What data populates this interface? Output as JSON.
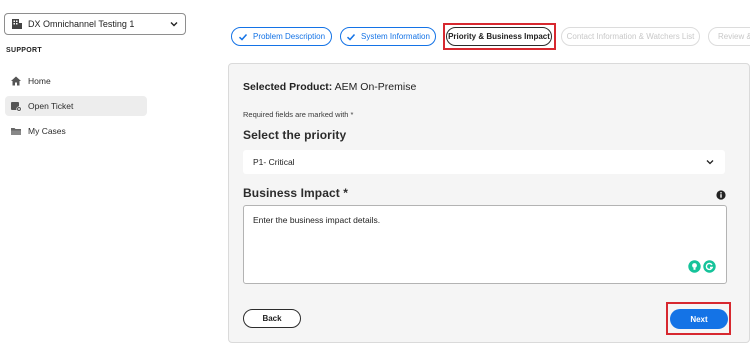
{
  "sidebar": {
    "org_selector": {
      "label": "DX Omnichannel Testing 1",
      "icon": "building-icon"
    },
    "section_label": "SUPPORT",
    "items": [
      {
        "label": "Home",
        "icon": "home-icon",
        "active": false
      },
      {
        "label": "Open Ticket",
        "icon": "ticket-icon",
        "active": true
      },
      {
        "label": "My Cases",
        "icon": "folder-icon",
        "active": false
      }
    ]
  },
  "stepper": {
    "steps": [
      {
        "label": "Problem Description",
        "state": "done"
      },
      {
        "label": "System Information",
        "state": "done"
      },
      {
        "label": "Priority & Business Impact",
        "state": "current"
      },
      {
        "label": "Contact Information & Watchers List",
        "state": "todo"
      },
      {
        "label": "Review &",
        "state": "todo"
      }
    ]
  },
  "form": {
    "selected_product_label": "Selected Product:",
    "selected_product_value": "AEM On-Premise",
    "required_note": "Required fields are marked with *",
    "priority_heading": "Select the priority",
    "priority_value": "P1- Critical",
    "impact_heading": "Business Impact *",
    "impact_placeholder": "Enter the business impact details.",
    "back_label": "Back",
    "next_label": "Next"
  },
  "colors": {
    "accent": "#1473e6",
    "highlight": "#d7282f",
    "panel_bg": "#f5f5f5",
    "grammarly": "#15c39a"
  }
}
